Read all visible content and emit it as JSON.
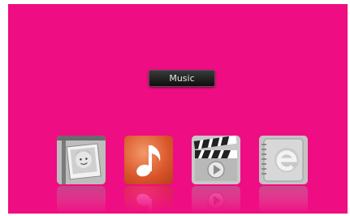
{
  "menu": {
    "selected_label": "Music"
  },
  "dock": {
    "items": [
      {
        "id": "photo",
        "icon": "photo-icon"
      },
      {
        "id": "music",
        "icon": "music-note-icon"
      },
      {
        "id": "video",
        "icon": "clapperboard-icon"
      },
      {
        "id": "ebook",
        "icon": "ebook-icon"
      }
    ]
  },
  "colors": {
    "background": "#ee0d82",
    "label_bg": "#1a1a1a",
    "label_text": "#e8e8e8",
    "music_accent": "#d9552a"
  }
}
